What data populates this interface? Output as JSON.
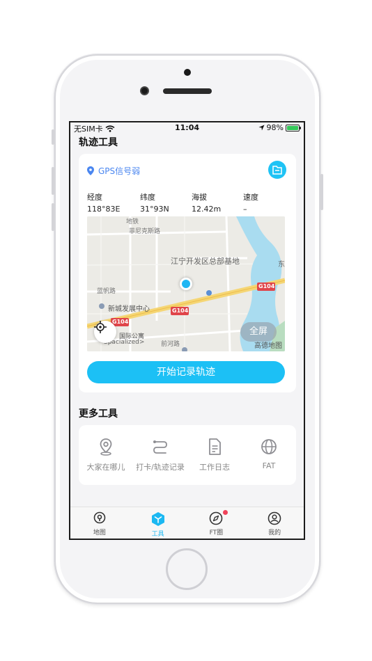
{
  "status_bar": {
    "carrier": "无SIM卡",
    "time": "11:04",
    "battery": "98%"
  },
  "track_section": {
    "title": "轨迹工具",
    "gps_status": "GPS信号弱",
    "info": [
      {
        "label": "经度",
        "value": "118°83E"
      },
      {
        "label": "纬度",
        "value": "31°93N"
      },
      {
        "label": "海拔",
        "value": "12.42m"
      },
      {
        "label": "速度",
        "value": "–"
      }
    ],
    "map": {
      "labels": {
        "district": "江宁开发区总部基地",
        "xincheng": "新城发展中心",
        "gongyu": "国际公寓",
        "road_feinike": "菲尼克斯路",
        "road_qiandi": "前河路",
        "road_lanfan": "蓝帆路",
        "road_g104_a": "G104",
        "road_g104_b": "G104",
        "road_g104_c": "G104",
        "road_ditie": "地铁",
        "east": "东",
        "spacialized": "Spacialized>"
      },
      "full_label": "全屏",
      "provider": "高德地图"
    },
    "start_button": "开始记录轨迹"
  },
  "more_tools": {
    "title": "更多工具",
    "items": [
      {
        "label": "大家在哪儿",
        "icon": "location-pin-icon"
      },
      {
        "label": "打卡/轨迹记录",
        "icon": "route-icon"
      },
      {
        "label": "工作日志",
        "icon": "document-icon"
      },
      {
        "label": "FAT",
        "icon": "globe-icon"
      }
    ]
  },
  "tab_bar": {
    "tabs": [
      {
        "label": "地图",
        "icon": "map-pin-icon"
      },
      {
        "label": "工具",
        "icon": "tools-cube-icon"
      },
      {
        "label": "FT圈",
        "icon": "compass-icon"
      },
      {
        "label": "我的",
        "icon": "profile-icon"
      }
    ]
  },
  "colors": {
    "accent": "#1cc0f5",
    "gps_text": "#4a86f0",
    "badge": "#f0435a",
    "battery": "#34c759"
  }
}
